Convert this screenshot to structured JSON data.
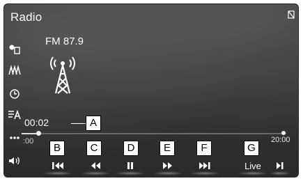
{
  "header": {
    "title": "Radio"
  },
  "station": {
    "frequency": "FM 87.9"
  },
  "timeline": {
    "elapsed": "00:02",
    "start_label": ":00",
    "end_label": "20:00",
    "progress": 0.16
  },
  "sidebar": {
    "items": [
      {
        "icon": "source-icon"
      },
      {
        "icon": "station-list-icon"
      },
      {
        "icon": "history-icon"
      },
      {
        "icon": "text-info-icon"
      },
      {
        "icon": "more-icon"
      },
      {
        "icon": "volume-icon"
      }
    ]
  },
  "controls": {
    "live_label": "Live"
  },
  "callouts": [
    "A",
    "B",
    "C",
    "D",
    "E",
    "F",
    "G"
  ]
}
